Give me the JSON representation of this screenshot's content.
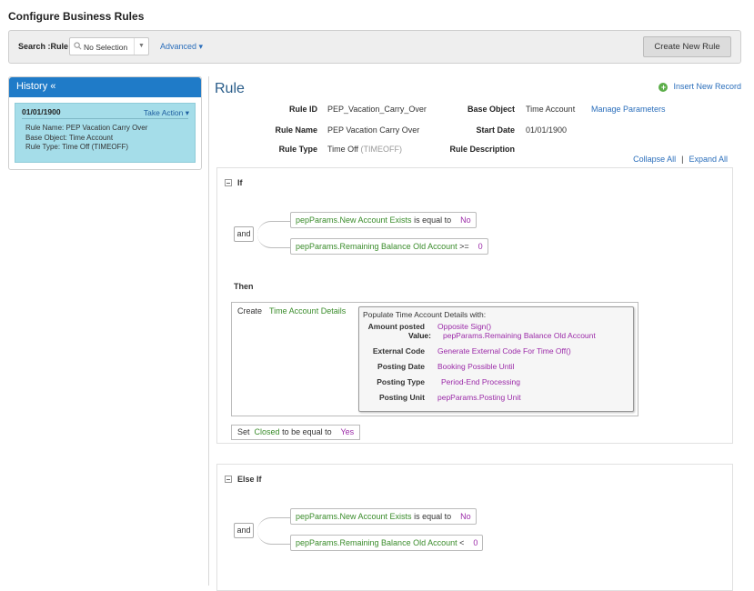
{
  "page_title": "Configure Business Rules",
  "search": {
    "label": "Search :Rule",
    "selection": "No Selection",
    "advanced": "Advanced",
    "create_button": "Create New Rule"
  },
  "history": {
    "title": "History «",
    "card": {
      "date": "01/01/1900",
      "action": "Take Action",
      "rule_name": "Rule Name: PEP Vacation Carry Over",
      "base_object": "Base Object: Time Account",
      "rule_type": "Rule Type: Time Off (TIMEOFF)"
    }
  },
  "rule": {
    "title": "Rule",
    "insert_record": "Insert New Record",
    "rule_id_label": "Rule ID",
    "rule_id_value": "PEP_Vacation_Carry_Over",
    "base_object_label": "Base Object",
    "base_object_value": "Time Account",
    "manage_parameters": "Manage Parameters",
    "rule_name_label": "Rule Name",
    "rule_name_value": "PEP Vacation Carry Over",
    "start_date_label": "Start Date",
    "start_date_value": "01/01/1900",
    "rule_type_label": "Rule Type",
    "rule_type_value": "Time Off",
    "rule_type_code": "(TIMEOFF)",
    "rule_description_label": "Rule Description",
    "collapse_all": "Collapse All",
    "expand_all": "Expand All"
  },
  "if_block": {
    "label": "If",
    "operator": "and",
    "conditions": [
      {
        "field": "pepParams.New Account Exists",
        "op": "is equal to",
        "value": "No"
      },
      {
        "field": "pepParams.Remaining Balance Old Account",
        "op": ">=",
        "value": "0"
      }
    ],
    "then_label": "Then",
    "create_text": "Create",
    "create_target": "Time Account Details",
    "populate_title": "Populate Time Account Details with:",
    "populate": [
      {
        "key": "Amount posted",
        "value": "Opposite Sign()"
      },
      {
        "key": "Value:",
        "value": "pepParams.Remaining Balance Old Account"
      },
      {
        "key": "External Code",
        "value": "Generate External Code For Time Off()"
      },
      {
        "key": "Posting Date",
        "value": "Booking Possible Until"
      },
      {
        "key": "Posting Type",
        "value": "Period-End Processing"
      },
      {
        "key": "Posting Unit",
        "value": "pepParams.Posting Unit"
      }
    ],
    "set_text": "Set",
    "set_field": "Closed",
    "set_op": "to be equal to",
    "set_value": "Yes"
  },
  "else_if_block": {
    "label": "Else If",
    "operator": "and",
    "conditions": [
      {
        "field": "pepParams.New Account Exists",
        "op": "is equal to",
        "value": "No"
      },
      {
        "field": "pepParams.Remaining Balance Old Account",
        "op": "<",
        "value": "0"
      }
    ]
  }
}
